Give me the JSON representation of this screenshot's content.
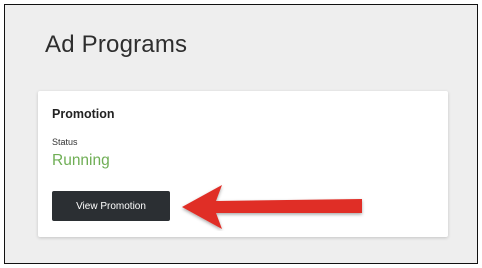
{
  "page": {
    "title": "Ad Programs"
  },
  "card": {
    "title": "Promotion",
    "status_label": "Status",
    "status_value": "Running",
    "button_label": "View Promotion"
  },
  "colors": {
    "background": "#eeeeee",
    "card": "#ffffff",
    "status_running": "#6fae55",
    "button": "#2b2f33",
    "annotation_arrow": "#e02f28"
  },
  "annotation": {
    "icon": "red-arrow-icon",
    "points_to": "view-promotion-button"
  }
}
